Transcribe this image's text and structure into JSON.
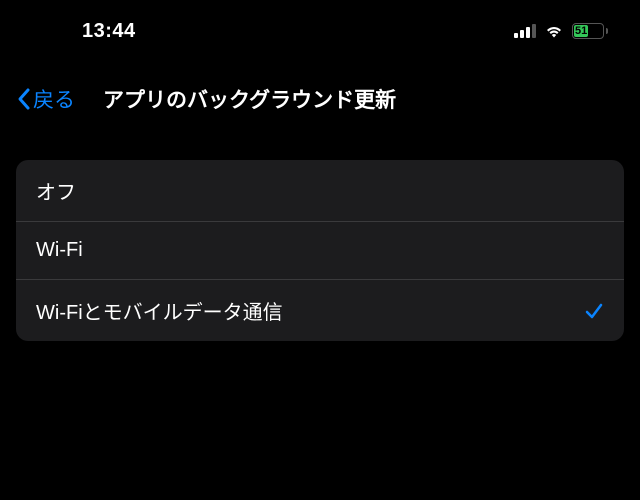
{
  "status_bar": {
    "time": "13:44",
    "battery_percent": "51",
    "battery_fill_width": "51%"
  },
  "nav": {
    "back_label": "戻る",
    "title": "アプリのバックグラウンド更新"
  },
  "options": [
    {
      "label": "オフ",
      "selected": false
    },
    {
      "label": "Wi-Fi",
      "selected": false
    },
    {
      "label": "Wi-Fiとモバイルデータ通信",
      "selected": true
    }
  ]
}
